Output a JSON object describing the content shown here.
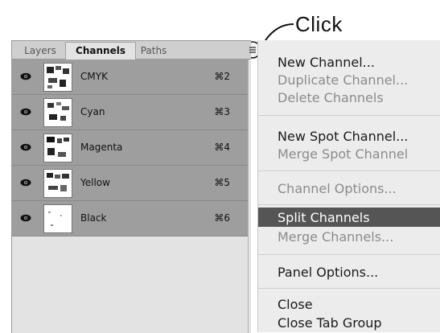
{
  "annotation": {
    "label": "Click"
  },
  "panel": {
    "tabs": [
      {
        "label": "Layers"
      },
      {
        "label": "Channels"
      },
      {
        "label": "Paths"
      }
    ],
    "channels": [
      {
        "name": "CMYK",
        "shortcut": "⌘2"
      },
      {
        "name": "Cyan",
        "shortcut": "⌘3"
      },
      {
        "name": "Magenta",
        "shortcut": "⌘4"
      },
      {
        "name": "Yellow",
        "shortcut": "⌘5"
      },
      {
        "name": "Black",
        "shortcut": "⌘6"
      }
    ],
    "menu_icon": "menu-icon",
    "visibility_icon": "eye-icon"
  },
  "menu": {
    "items": [
      {
        "label": "New Channel...",
        "enabled": true
      },
      {
        "label": "Duplicate Channel...",
        "enabled": false
      },
      {
        "label": "Delete Channels",
        "enabled": false
      },
      {
        "label": "New Spot Channel...",
        "enabled": true
      },
      {
        "label": "Merge Spot Channel",
        "enabled": false
      },
      {
        "label": "Channel Options...",
        "enabled": false
      },
      {
        "label": "Split Channels",
        "enabled": true,
        "highlighted": true
      },
      {
        "label": "Merge Channels...",
        "enabled": false
      },
      {
        "label": "Panel Options...",
        "enabled": true
      },
      {
        "label": "Close",
        "enabled": true
      },
      {
        "label": "Close Tab Group",
        "enabled": true
      }
    ]
  },
  "colors": {
    "row_bg": "#9e9e9e",
    "highlight": "#555555",
    "menu_bg": "#ececec"
  }
}
